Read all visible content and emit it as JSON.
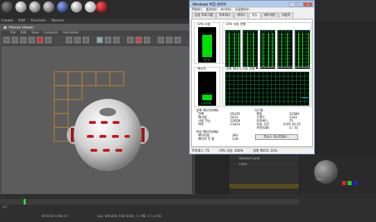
{
  "c4d": {
    "menu": [
      "Create",
      "Edit",
      "Function",
      "Texture"
    ],
    "viewer_title": "Picture Viewer",
    "viewer_menu": [
      "File",
      "Edit",
      "View",
      "Compare",
      "Animation"
    ],
    "timeline_left": "0 F",
    "timeline_status": "00:00:26  4.0Kb  0 F",
    "timeline_info": "Size: 800x600, RGB (8 Bit), 1.1 MB, (F 1 of 26)",
    "objects": [
      "Wandoo*Lamb",
      "Lamp",
      "",
      "",
      "",
      ""
    ],
    "attr_labels": [
      "Color",
      "Brightness",
      "Texture"
    ]
  },
  "taskmgr": {
    "title": "Windows 작업 관리자",
    "menu": [
      "파일(F)",
      "옵션(O)",
      "보기(V)",
      "도움말(H)"
    ],
    "tabs": [
      "응용 프로그램",
      "프로세스",
      "서비스",
      "성능",
      "네트워킹",
      "사용자"
    ],
    "active_tab": "성능",
    "cpu_usage_label": "CPU 사용",
    "cpu_usage_value": "79 %",
    "cpu_usage_percent": 79,
    "cpu_history_label": "CPU 사용 현황",
    "memory_label": "메모리",
    "memory_value": "3.62GB",
    "memory_percent": 22,
    "memory_history_label": "실제 메모리 사용 현황",
    "physical_memory": {
      "heading": "실제 메모리(MB)",
      "rows": [
        {
          "label": "전체",
          "value": "16335"
        },
        {
          "label": "캐시됨",
          "value": "1413"
        },
        {
          "label": "사용 가능",
          "value": "12659"
        },
        {
          "label": "여유",
          "value": "11423"
        }
      ]
    },
    "kernel_memory": {
      "heading": "커널 메모리(MB)",
      "rows": [
        {
          "label": "페이지됨",
          "value": "391"
        },
        {
          "label": "페이지 안 됨",
          "value": "118"
        }
      ]
    },
    "system": {
      "heading": "시스템",
      "rows": [
        {
          "label": "핸들",
          "value": "12384"
        },
        {
          "label": "스레드",
          "value": "1142"
        },
        {
          "label": "프로세스",
          "value": "75"
        },
        {
          "label": "작동 시간",
          "value": "0:05:10:15"
        },
        {
          "label": "커밋(GB)",
          "value": "5 / 31"
        }
      ]
    },
    "resmon_button": "리소스 모니터(R)...",
    "status": {
      "processes": "프로세스: 75",
      "cpu": "CPU 사용: 100%",
      "memory": "실제 메모리: 22%"
    }
  }
}
